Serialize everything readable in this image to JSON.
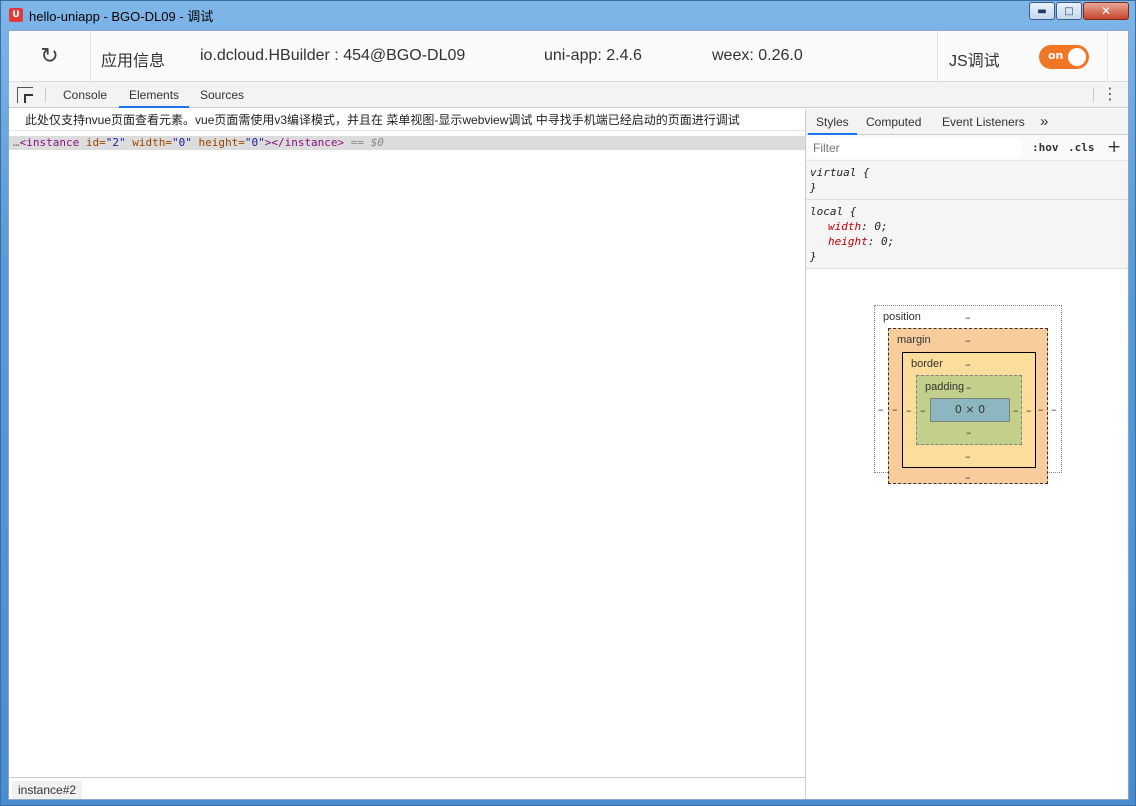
{
  "window": {
    "title": "hello-uniapp - BGO-DL09 - 调试",
    "app_icon": "uniapp-logo-icon"
  },
  "infobar": {
    "app_info_label": "应用信息",
    "app_id": "io.dcloud.HBuilder : 454@BGO-DL09",
    "uniapp_version": "uni-app: 2.4.6",
    "weex_version": "weex: 0.26.0",
    "js_debug_label": "JS调试",
    "toggle_label": "on",
    "toggle_color": "#f07624"
  },
  "tabs": {
    "console": "Console",
    "elements": "Elements",
    "sources": "Sources"
  },
  "elements": {
    "notice": "此处仅支持nvue页面查看元素。vue页面需使用v3编译模式，并且在 菜单视图-显示webview调试 中寻找手机端已经启动的页面进行调试",
    "dom": {
      "dots": "…",
      "open_tag": "<instance",
      "attr1_name": " id=",
      "attr1_val": "\"2\"",
      "attr2_name": " width=",
      "attr2_val": "\"0\"",
      "attr3_name": " height=",
      "attr3_val": "\"0\"",
      "close": "></instance>",
      "eq": " == ",
      "ref": "$0"
    },
    "breadcrumb": "instance#2"
  },
  "sidebar": {
    "tabs": {
      "styles": "Styles",
      "computed": "Computed",
      "listeners": "Event Listeners",
      "more": "»"
    },
    "filter_placeholder": "Filter",
    "hov": ":hov",
    "cls": ".cls",
    "plus": "+",
    "rules": [
      {
        "selector": "virtual {",
        "props": [],
        "close": "}"
      },
      {
        "selector": "local {",
        "props": [
          {
            "name": "width",
            "value": ": 0;"
          },
          {
            "name": "height",
            "value": ": 0;"
          }
        ],
        "close": "}"
      }
    ],
    "boxmodel": {
      "position": "position",
      "margin": "margin",
      "border": "border",
      "padding": "padding",
      "content": "0 × 0",
      "dash": "–"
    }
  }
}
